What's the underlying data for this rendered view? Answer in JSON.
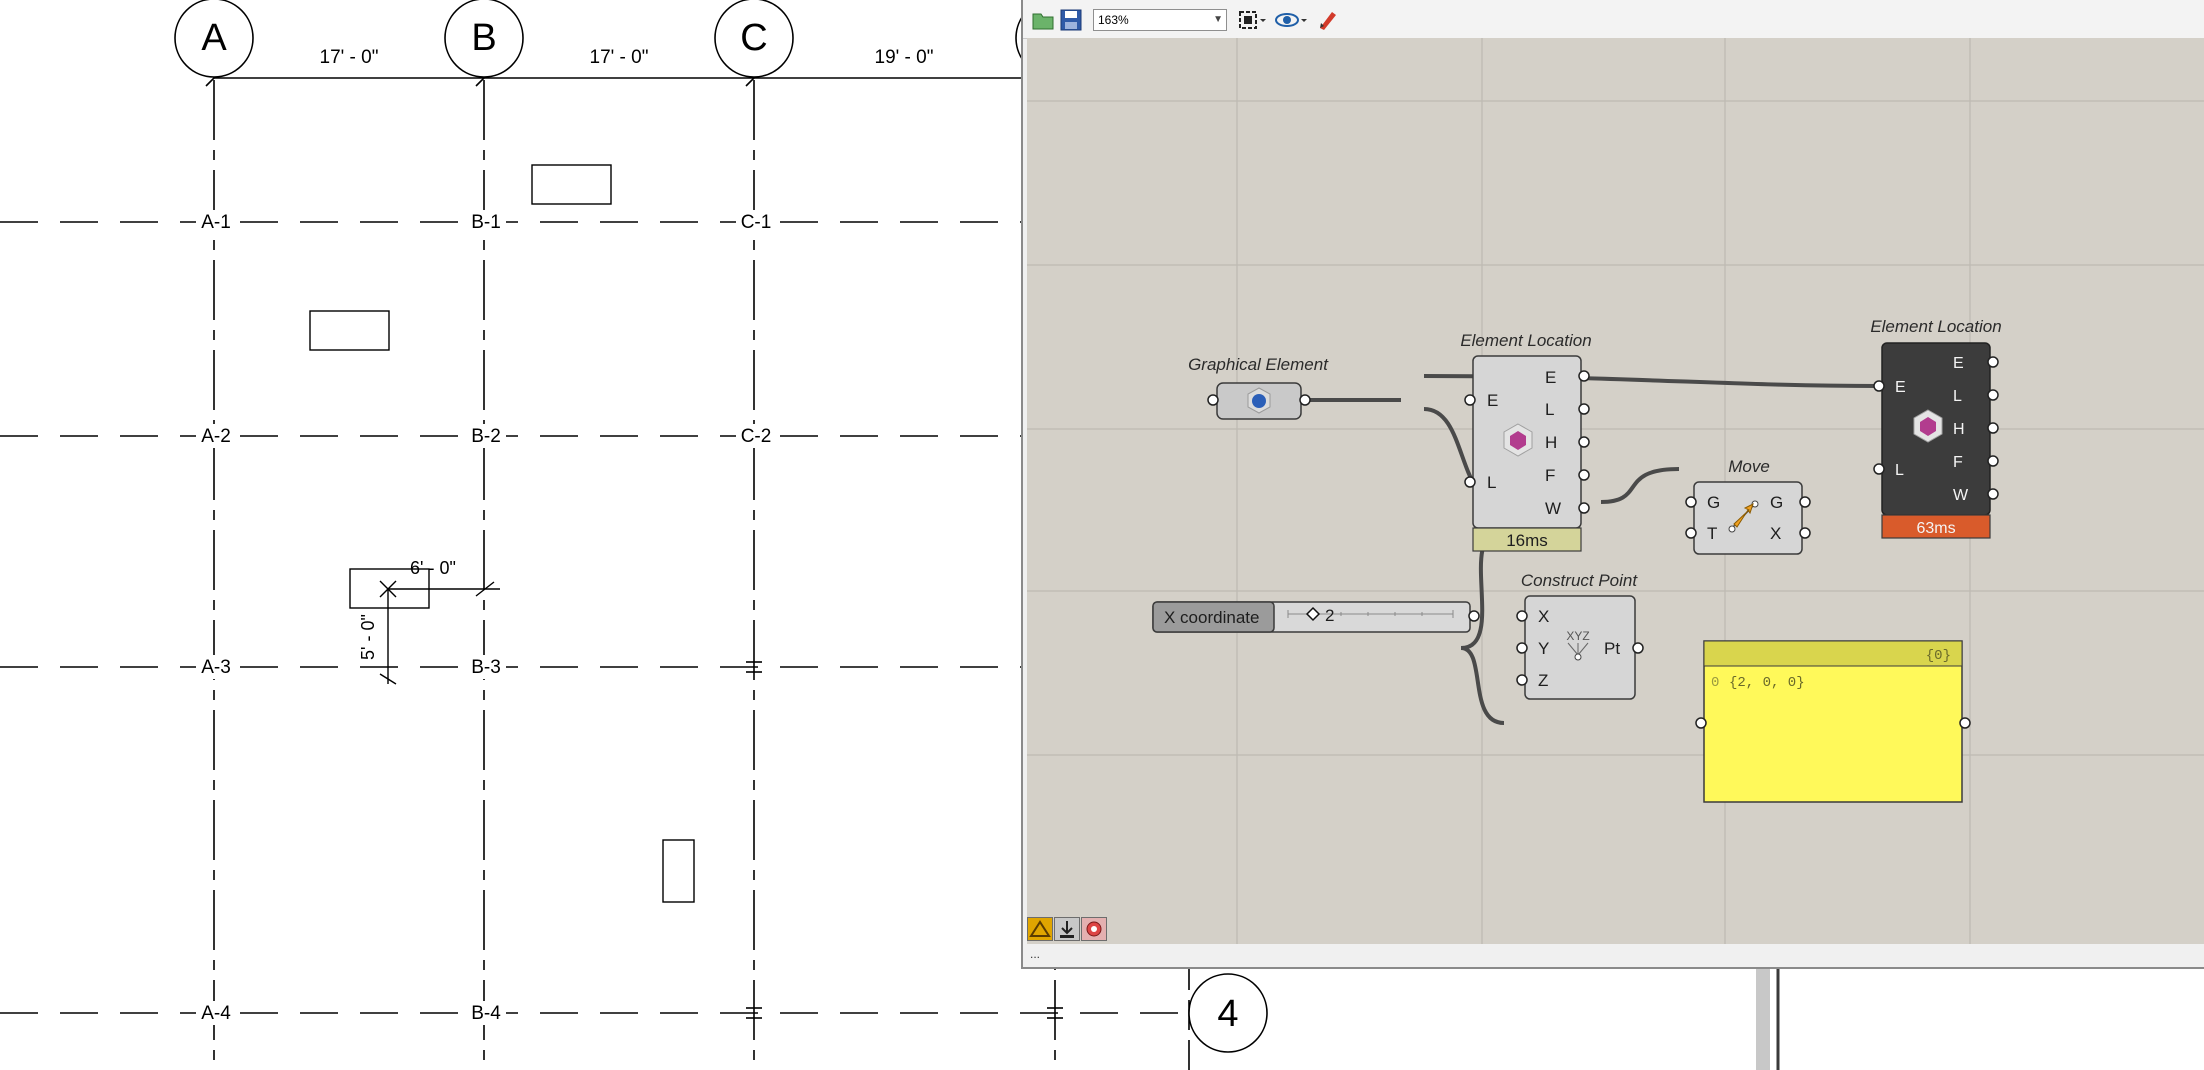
{
  "plan": {
    "grid_bubbles": [
      "A",
      "B",
      "C",
      "4"
    ],
    "dimensions_top": [
      "17' - 0\"",
      "17' - 0\"",
      "19' - 0\""
    ],
    "grid_intersections": [
      "A-1",
      "B-1",
      "C-1",
      "A-2",
      "B-2",
      "C-2",
      "A-3",
      "B-3",
      "A-4",
      "B-4"
    ],
    "dim_horizontal": "6' - 0\"",
    "dim_vertical": "5' - 0\""
  },
  "toolbar": {
    "open_icon": "folder-open-icon",
    "save_icon": "save-icon",
    "zoom_value": "163%",
    "zoom_options": [
      "163%"
    ],
    "zoom_extents_icon": "zoom-extents-icon",
    "preview_icon": "eye-icon",
    "sketch_icon": "pencil-icon"
  },
  "canvas": {
    "graphical_element": {
      "label": "Graphical Element"
    },
    "element_location_1": {
      "label": "Element Location",
      "inputs": [
        "E",
        "L"
      ],
      "outputs": [
        "E",
        "L",
        "H",
        "F",
        "W"
      ],
      "timing": "16ms"
    },
    "element_location_2": {
      "label": "Element Location",
      "inputs": [
        "E",
        "L"
      ],
      "outputs": [
        "E",
        "L",
        "H",
        "F",
        "W"
      ],
      "timing": "63ms",
      "timing_color": "#d95b2b"
    },
    "move": {
      "label": "Move",
      "inputs": [
        "G",
        "T"
      ],
      "outputs": [
        "G",
        "X"
      ]
    },
    "slider": {
      "name": "X coordinate",
      "value": "2"
    },
    "construct_point": {
      "label": "Construct Point",
      "inputs": [
        "X",
        "Y",
        "Z"
      ],
      "output": "Pt",
      "icon_text": "XYZ"
    },
    "panel": {
      "path": "{0}",
      "index": "0",
      "value": "{2, 0, 0}",
      "color": "#fff95a"
    }
  },
  "bottom_buttons": [
    "grasshopper-icon",
    "download-icon",
    "rhino-icon"
  ],
  "status": "..."
}
